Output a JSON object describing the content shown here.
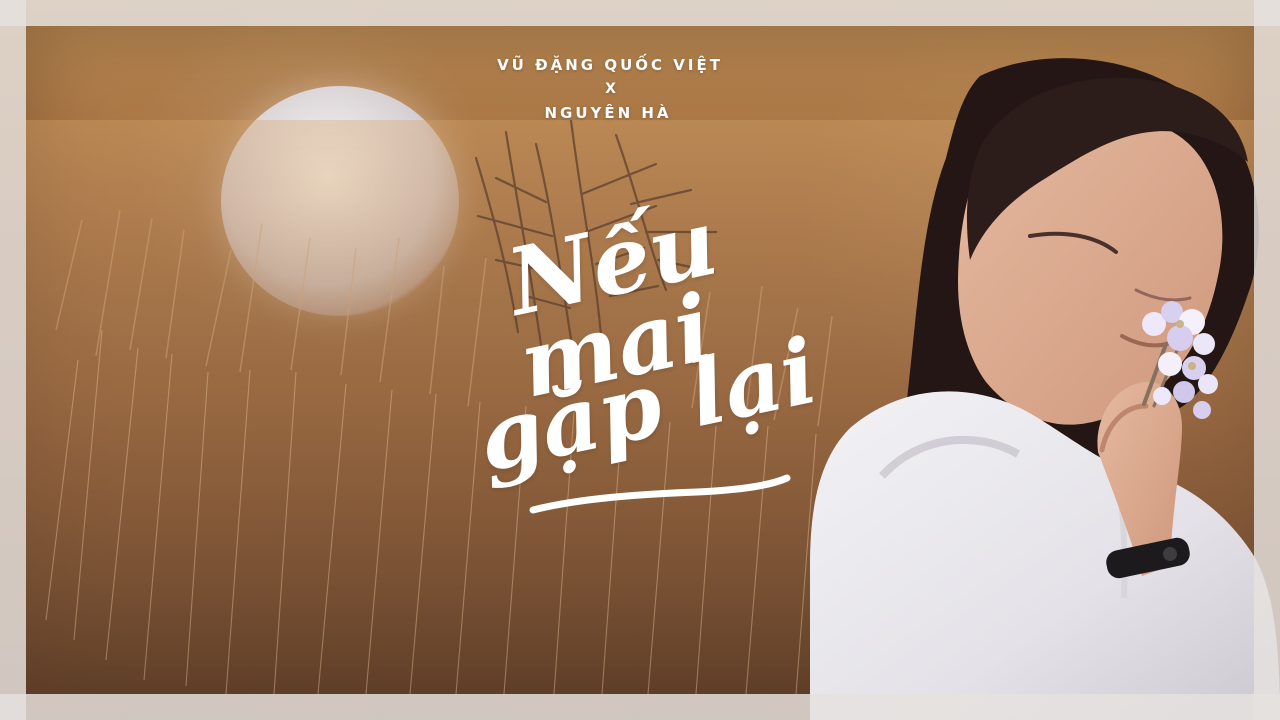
{
  "poster": {
    "credits": {
      "line_1": "VŨ ĐẶNG QUỐC VIỆT",
      "separator": "X",
      "line_2": "NGUYÊN HÀ"
    },
    "title_lines": [
      "Nếu",
      "mai",
      "gặp lại"
    ]
  },
  "colors": {
    "accent_text": "#FFFFFF",
    "frame_tint": "#D8D4D0",
    "field_gold": "#B48753",
    "field_brown": "#6F4A31",
    "shirt_white": "#E8E7EA",
    "hair_dark": "#241717",
    "flower_lilac": "#D9D1F1"
  },
  "icons": [
    "sun-glow-icon",
    "grass-sprig-icon",
    "flower-bouquet-icon"
  ]
}
